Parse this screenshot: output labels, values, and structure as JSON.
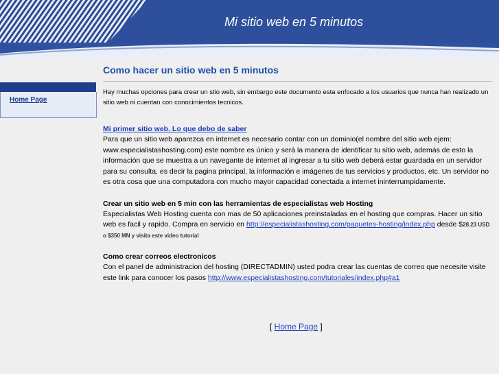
{
  "header": {
    "title": "Mi sitio web en 5 minutos",
    "colors": {
      "banner_dark": "#1f3f8a",
      "banner_mid": "#3b5ba9",
      "banner_light": "#c9d4ea"
    }
  },
  "sidebar": {
    "items": [
      {
        "label": "Home Page"
      }
    ]
  },
  "main": {
    "title": "Como hacer un sitio web en 5 minutos",
    "intro": "Hay muchas opciones para crear un stio web, sin embargo este documento esta enfocado a los usuarios que nunca han realizado un sitio web ni cuentan con conocimientos tecnicos.",
    "section1": {
      "link": " Mi primer sitio web. Lo que debo de saber",
      "body": "Para que un sitio web aparezca en internet es necesario contar con un dominio(el nombre del sitio web ejem: www.especialistashosting.com) este nombre es único y será la manera de identificar tu sitio web, además de esto la información que se muestra a un navegante de internet al ingresar a tu sitio web deberá estar guardada en un servidor para su consulta, es decir la pagina principal, la información e imágenes de tus servicios y productos, etc. Un servidor no es otra cosa que una computadora con mucho mayor capacidad conectada a internet ininterrumpidamente."
    },
    "section2": {
      "heading": "Crear un sitio web en 5 min con las herramientas de especialistas web Hosting",
      "body": "Especialistas Web Hosting cuenta con mas de 50 aplicaciones preinstaladas en el hosting que compras. Hacer un sitio web es facil y rapido. Compra en servicio en ",
      "link": "http://especialistashosting.com/paquetes-hosting/index.php",
      "after": " desde $",
      "price": "28.23 USD o $350 MN y visita este video tutorial"
    },
    "section3": {
      "heading": "Como crear correos electronicos",
      "body": "Con el panel de administracion del hosting (DIRECTADMIN) usted podra crear las cuentas de correo que necesite visite este link para conocer los pasos ",
      "link": "http://www.especialistashosting.com/tutoriales/index.php#a1"
    }
  },
  "footer": {
    "open": "[ ",
    "link": "Home Page",
    "close": " ]"
  }
}
